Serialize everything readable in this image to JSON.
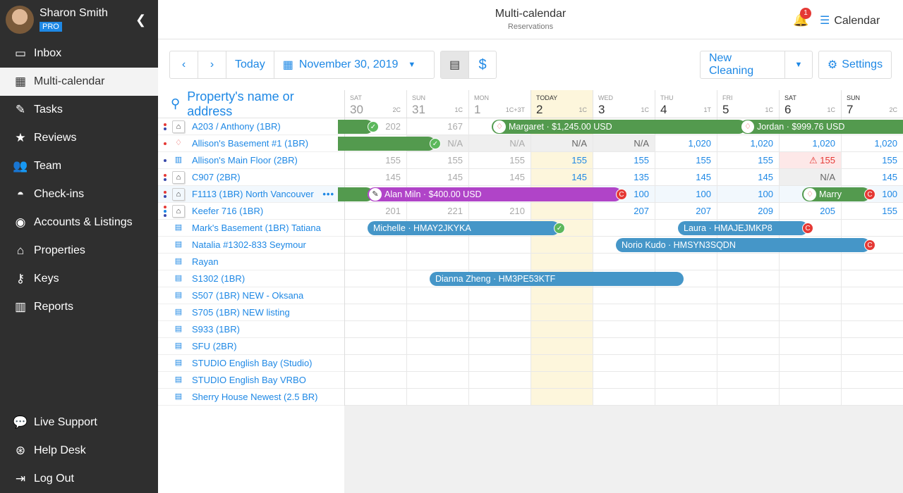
{
  "user": {
    "name": "Sharon Smith",
    "plan": "PRO"
  },
  "sidebar": {
    "items": [
      {
        "label": "Inbox",
        "icon": "inbox-icon",
        "glyph": "▭"
      },
      {
        "label": "Multi-calendar",
        "icon": "calendar-icon",
        "glyph": "▦",
        "active": true
      },
      {
        "label": "Tasks",
        "icon": "tasks-icon",
        "glyph": "✎"
      },
      {
        "label": "Reviews",
        "icon": "star-icon",
        "glyph": "★"
      },
      {
        "label": "Team",
        "icon": "team-icon",
        "glyph": "👥"
      },
      {
        "label": "Check-ins",
        "icon": "bell-service-icon",
        "glyph": "◓"
      },
      {
        "label": "Accounts & Listings",
        "icon": "account-icon",
        "glyph": "◉"
      },
      {
        "label": "Properties",
        "icon": "home-icon",
        "glyph": "⌂"
      },
      {
        "label": "Keys",
        "icon": "key-icon",
        "glyph": "⚷"
      },
      {
        "label": "Reports",
        "icon": "reports-icon",
        "glyph": "▥"
      }
    ],
    "bottom": [
      {
        "label": "Live Support",
        "icon": "chat-icon",
        "glyph": "💬"
      },
      {
        "label": "Help Desk",
        "icon": "lifebuoy-icon",
        "glyph": "⊛"
      },
      {
        "label": "Log Out",
        "icon": "logout-icon",
        "glyph": "⇥"
      }
    ]
  },
  "header": {
    "title": "Multi-calendar",
    "subtitle": "Reservations",
    "notifications": "1",
    "view": "Calendar"
  },
  "toolbar": {
    "today": "Today",
    "date": "November 30, 2019",
    "new_cleaning": "New Cleaning",
    "settings": "Settings"
  },
  "search": {
    "placeholder": "Property's name or address"
  },
  "days": [
    {
      "w": "SAT",
      "n": "30",
      "c": "2C",
      "past": true
    },
    {
      "w": "SUN",
      "n": "31",
      "c": "1C",
      "past": true
    },
    {
      "w": "MON",
      "n": "1",
      "c": "1C+3T",
      "past": true
    },
    {
      "w": "TODAY",
      "n": "2",
      "c": "1C",
      "today": true
    },
    {
      "w": "WED",
      "n": "3",
      "c": "1C"
    },
    {
      "w": "THU",
      "n": "4",
      "c": "1T"
    },
    {
      "w": "FRI",
      "n": "5",
      "c": "1C"
    },
    {
      "w": "SAT",
      "n": "6",
      "c": "1C"
    },
    {
      "w": "SUN",
      "n": "7",
      "c": "2C"
    }
  ],
  "properties": [
    {
      "name": "A203 / Anthony (1BR)",
      "icon": "home",
      "dots": [
        "#e53935",
        "#3949ab"
      ],
      "cells": [
        "202",
        "167",
        "",
        "",
        "",
        "",
        "",
        "",
        ""
      ]
    },
    {
      "name": "Allison's Basement #1 (1BR)",
      "icon": "airbnb",
      "dots": [
        "#e53935"
      ],
      "cells": [
        "",
        "N/A",
        "N/A",
        "N/A",
        "N/A",
        "1,020",
        "1,020",
        "1,020",
        "1,020"
      ]
    },
    {
      "name": "Allison's Main Floor (2BR)",
      "icon": "building",
      "dots": [
        "#3949ab"
      ],
      "cells": [
        "155",
        "155",
        "155",
        "155",
        "155",
        "155",
        "155",
        "155",
        "155"
      ]
    },
    {
      "name": "C907 (2BR)",
      "icon": "home",
      "dots": [
        "#e53935",
        "#3949ab"
      ],
      "cells": [
        "145",
        "145",
        "145",
        "145",
        "135",
        "145",
        "145",
        "N/A",
        "145"
      ]
    },
    {
      "name": "F1113 (1BR) North Vancouver",
      "icon": "home",
      "dots": [
        "#e53935",
        "#3949ab"
      ],
      "cells": [
        "",
        "",
        "",
        "",
        "100",
        "100",
        "100",
        "",
        "100"
      ],
      "hover": true
    },
    {
      "name": "Keefer 716 (1BR)",
      "icon": "home",
      "dots": [
        "#e53935",
        "#1e88e5",
        "#3949ab"
      ],
      "cells": [
        "201",
        "221",
        "210",
        "",
        "207",
        "207",
        "209",
        "205",
        "155"
      ]
    },
    {
      "name": "Mark's Basement (1BR) Tatiana",
      "icon": "list"
    },
    {
      "name": "Natalia #1302-833 Seymour",
      "icon": "list"
    },
    {
      "name": "Rayan",
      "icon": "list"
    },
    {
      "name": "S1302 (1BR)",
      "icon": "list"
    },
    {
      "name": "S507 (1BR) NEW - Oksana",
      "icon": "list"
    },
    {
      "name": "S705 (1BR) NEW listing",
      "icon": "list"
    },
    {
      "name": "S933 (1BR)",
      "icon": "list"
    },
    {
      "name": "SFU (2BR)",
      "icon": "list"
    },
    {
      "name": "STUDIO English Bay (Studio)",
      "icon": "list"
    },
    {
      "name": "STUDIO English Bay VRBO",
      "icon": "list"
    },
    {
      "name": "Sherry House Newest (2.5 BR)",
      "icon": "list"
    }
  ],
  "bookings": [
    {
      "row": 0,
      "from": -1,
      "to": 0,
      "label": "",
      "color": "#539a4e",
      "end": "check"
    },
    {
      "row": 0,
      "from": 2,
      "to": 6,
      "label": "Margaret · $1,245.00 USD",
      "color": "#539a4e",
      "source": "airbnb"
    },
    {
      "row": 0,
      "from": 6,
      "to": 10,
      "label": "Jordan · $999.76 USD",
      "color": "#539a4e",
      "source": "airbnb"
    },
    {
      "row": 1,
      "from": -1,
      "to": 1,
      "label": "",
      "color": "#539a4e",
      "end": "check"
    },
    {
      "row": 4,
      "from": -1,
      "to": 0,
      "label": "",
      "color": "#539a4e",
      "end": "check"
    },
    {
      "row": 4,
      "from": 0,
      "to": 4,
      "label": "Alan Miln · $400.00 USD",
      "color": "#b044c8",
      "source": "manual",
      "end": "C"
    },
    {
      "row": 4,
      "from": 7,
      "to": 8,
      "label": "Marry",
      "color": "#539a4e",
      "source": "airbnb",
      "end": "C"
    },
    {
      "row": 6,
      "from": 0,
      "to": 3,
      "label": "Michelle · HMAY2JKYKA",
      "color": "#4596c8",
      "end": "check"
    },
    {
      "row": 6,
      "from": 5,
      "to": 7,
      "label": "Laura · HMAJEJMKP8",
      "color": "#4596c8",
      "end": "C"
    },
    {
      "row": 7,
      "from": 4,
      "to": 8,
      "label": "Norio Kudo · HMSYN3SQDN",
      "color": "#4596c8",
      "end": "C"
    },
    {
      "row": 9,
      "from": 1,
      "to": 5,
      "label": "Dianna Zheng · HM3PE53KTF",
      "color": "#4596c8"
    }
  ],
  "colors": {
    "accent": "#1e88e5",
    "green": "#539a4e",
    "purple": "#b044c8",
    "blue": "#4596c8",
    "today": "#fdf6dc",
    "warning": "#e53935"
  }
}
